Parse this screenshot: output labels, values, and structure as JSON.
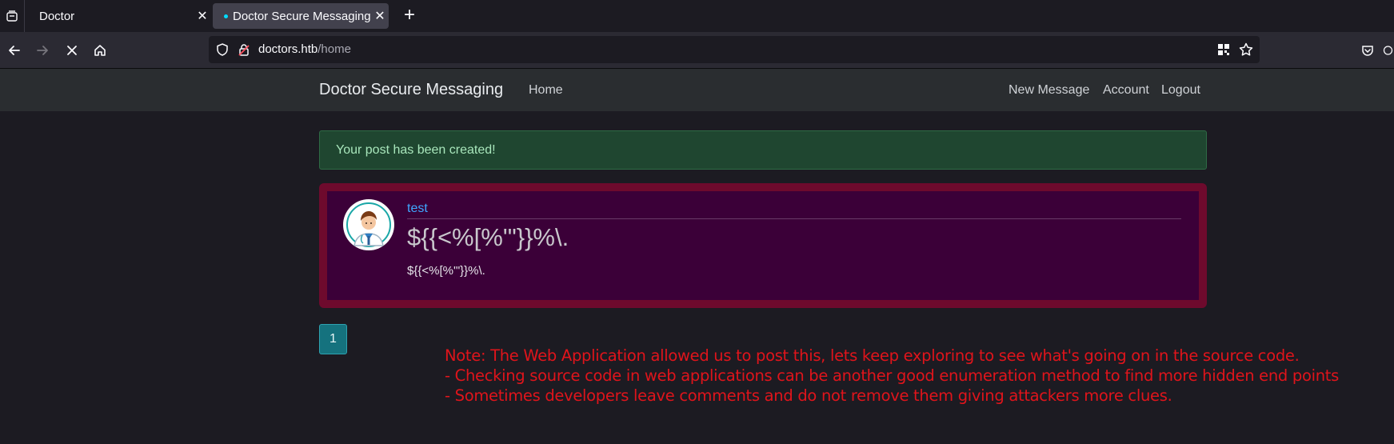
{
  "browser": {
    "tabs": [
      {
        "label": "Doctor"
      },
      {
        "label": "Doctor Secure Messaging"
      }
    ],
    "url_host": "doctors.htb",
    "url_path": "/home"
  },
  "site": {
    "brand": "Doctor Secure Messaging",
    "nav_left": [
      "Home"
    ],
    "nav_right": [
      "New Message",
      "Account",
      "Logout"
    ]
  },
  "alert": {
    "text": "Your post has been created!"
  },
  "post": {
    "author": "test",
    "title": "${{<%[%'\"}}%\\.",
    "body": "${{<%[%'\"}}%\\."
  },
  "pagination": {
    "current_page": "1"
  },
  "note": {
    "lines": [
      "Note: The Web Application allowed us to post this, lets keep exploring to see what's going on in the source code.",
      "- Checking source code in web applications can be another good enumeration method to find more hidden end points",
      "- Sometimes developers leave comments and do not remove them giving attackers more clues."
    ]
  },
  "colors": {
    "accent_link": "#3fa7ff",
    "alert_bg": "#1f4630",
    "post_border": "#6e0a2d",
    "post_bg": "#3b0038",
    "note_red": "#e0141b"
  }
}
